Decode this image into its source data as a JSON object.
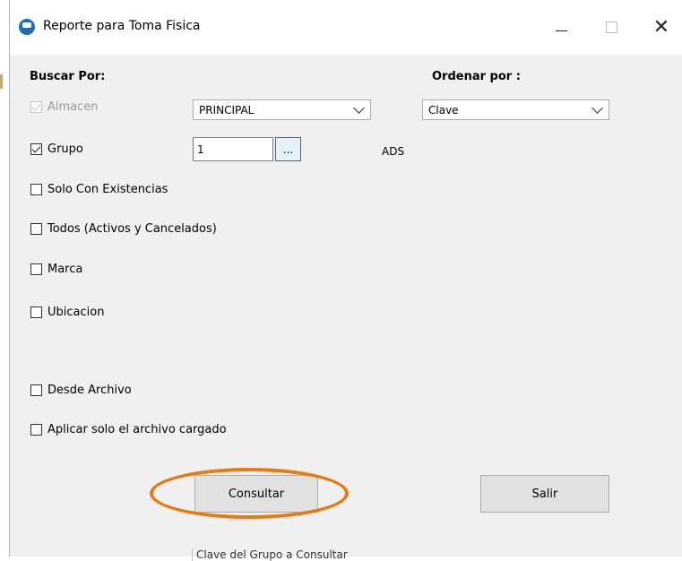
{
  "window": {
    "title": "Reporte para Toma Fisica"
  },
  "labels": {
    "buscar_por": "Buscar Por:",
    "ordenar_por": "Ordenar por :"
  },
  "almacen": {
    "label": "Almacen",
    "checked": true,
    "disabled": true,
    "selected": "PRINCIPAL"
  },
  "ordenar": {
    "selected": "Clave"
  },
  "grupo": {
    "label": "Grupo",
    "checked": true,
    "value": "1",
    "browse_label": "...",
    "description": "ADS"
  },
  "options": [
    {
      "label": "Solo Con Existencias",
      "checked": false
    },
    {
      "label": "Todos (Activos y Cancelados)",
      "checked": false
    },
    {
      "label": "Marca",
      "checked": false
    },
    {
      "label": "Ubicacion",
      "checked": false
    },
    {
      "label": "Desde Archivo",
      "checked": false
    },
    {
      "label": "Aplicar solo el archivo cargado",
      "checked": false
    }
  ],
  "buttons": {
    "consultar": "Consultar",
    "salir": "Salir"
  },
  "bottom_partial_text": "Clave del Grupo a Consultar",
  "colors": {
    "highlight": "#e57b14",
    "focus_border": "#0078d7"
  }
}
